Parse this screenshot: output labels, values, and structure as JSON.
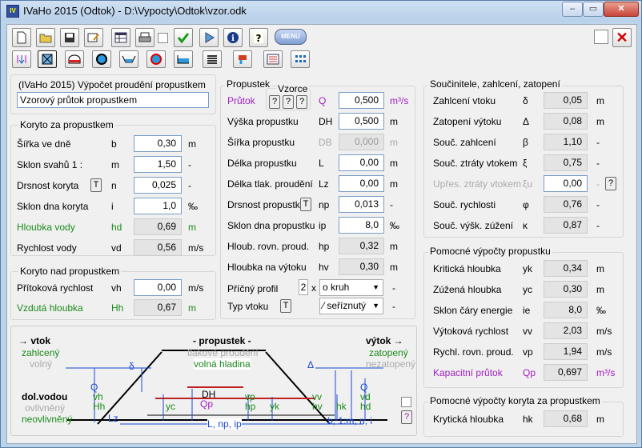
{
  "window": {
    "title": "IVaHo 2015 (Odtok)  -  D:\\Vypocty\\Odtok\\vzor.odk",
    "min": "–",
    "max": "▭",
    "close": "✕"
  },
  "toolbar": {
    "menu_label": "MENU",
    "close": "✕"
  },
  "left": {
    "header": "(IVaHo 2015) Výpočet proudění propustkem",
    "name_value": "Vzorový průtok propustkem",
    "koryto_za": {
      "title": "Koryto za propustkem",
      "rows": [
        {
          "label": "Šířka ve dně",
          "sym": "b",
          "value": "0,30",
          "unit": "m"
        },
        {
          "label": "Sklon svahů  1 :",
          "sym": "m",
          "value": "1,50",
          "unit": "-"
        },
        {
          "label": "Drsnost koryta",
          "sym": "n",
          "value": "0,025",
          "unit": "-",
          "t": "T"
        },
        {
          "label": "Sklon dna koryta",
          "sym": "i",
          "value": "1,0",
          "unit": "‰"
        },
        {
          "label": "Hloubka vody",
          "sym": "hd",
          "value": "0,69",
          "unit": "m"
        },
        {
          "label": "Rychlost vody",
          "sym": "vd",
          "value": "0,56",
          "unit": "m/s"
        }
      ]
    },
    "koryto_nad": {
      "title": "Koryto nad propustkem",
      "rows": [
        {
          "label": "Přítoková rychlost",
          "sym": "vh",
          "value": "0,00",
          "unit": "m/s"
        },
        {
          "label": "Vzdutá hloubka",
          "sym": "Hh",
          "value": "0,67",
          "unit": "m"
        }
      ]
    }
  },
  "mid": {
    "title": "Propustek",
    "vzorce": "Vzorce",
    "q": "?",
    "rows": [
      {
        "label": "Průtok",
        "sym": "Q",
        "value": "0,500",
        "unit": "m³/s"
      },
      {
        "label": "Výška propustku",
        "sym": "DH",
        "value": "0,500",
        "unit": "m"
      },
      {
        "label": "Šířka propustku",
        "sym": "DB",
        "value": "0,000",
        "unit": "m"
      },
      {
        "label": "Délka propustku",
        "sym": "L",
        "value": "0,00",
        "unit": "m"
      },
      {
        "label": "Délka tlak. proudění",
        "sym": "Lz",
        "value": "0,00",
        "unit": "m"
      },
      {
        "label": "Drsnost propustku",
        "sym": "np",
        "value": "0,013",
        "unit": "-",
        "t": "T"
      },
      {
        "label": "Sklon dna propustku",
        "sym": "ip",
        "value": "8,0",
        "unit": "‰"
      },
      {
        "label": "Hloub. rovn. proud.",
        "sym": "hp",
        "value": "0,32",
        "unit": "m"
      },
      {
        "label": "Hloubka na výtoku",
        "sym": "hv",
        "value": "0,30",
        "unit": "m"
      }
    ],
    "profil": {
      "label": "Příčný profil",
      "count": "2",
      "x": "x",
      "value": "o  kruh",
      "unit": "-"
    },
    "vtok": {
      "label": "Typ vtoku",
      "t": "T",
      "value": "⁄  seříznutý",
      "unit": "-"
    }
  },
  "right": {
    "title": "Součinitele, zahlcení, zatopení",
    "rows": [
      {
        "label": "Zahlcení vtoku",
        "sym": "δ",
        "value": "0,05",
        "unit": "m"
      },
      {
        "label": "Zatopení výtoku",
        "sym": "Δ",
        "value": "0,08",
        "unit": "m"
      },
      {
        "label": "Souč. zahlcení",
        "sym": "β",
        "value": "1,10",
        "unit": "-"
      },
      {
        "label": "Souč. ztráty vtokem",
        "sym": "ξ",
        "value": "0,75",
        "unit": "-"
      },
      {
        "label": "Upřes. ztráty vtokem",
        "sym": "ξu",
        "value": "0,00",
        "unit": "-",
        "q": "?"
      },
      {
        "label": "Souč. rychlosti",
        "sym": "φ",
        "value": "0,76",
        "unit": "-"
      },
      {
        "label": "Souč. výšk. zúžení",
        "sym": "κ",
        "value": "0,87",
        "unit": "-"
      }
    ],
    "pomocne": {
      "title": "Pomocné výpočty propustku",
      "rows": [
        {
          "label": "Kritická hloubka",
          "sym": "yk",
          "value": "0,34",
          "unit": "m"
        },
        {
          "label": "Zúžená hloubka",
          "sym": "yc",
          "value": "0,30",
          "unit": "m"
        },
        {
          "label": "Sklon čáry energie",
          "sym": "ie",
          "value": "8,0",
          "unit": "‰"
        },
        {
          "label": "Výtoková rychlost",
          "sym": "vv",
          "value": "2,03",
          "unit": "m/s"
        },
        {
          "label": "Rychl. rovn. proud.",
          "sym": "vp",
          "value": "1,94",
          "unit": "m/s"
        },
        {
          "label": "Kapacitní průtok",
          "sym": "Qp",
          "value": "0,697",
          "unit": "m³/s"
        }
      ]
    },
    "pomocne_koryto": {
      "title": "Pomocné výpočty koryta za propustkem",
      "row": {
        "label": "Krytická hloubka",
        "sym": "hk",
        "value": "0,68",
        "unit": "m"
      }
    }
  },
  "diagram": {
    "vtok": "→  vtok",
    "zahlceny": "zahlcený",
    "volny": "volný",
    "propustek": "- propustek -",
    "tlakove": "tlakové proudění",
    "volna_hladina": "volná hladina",
    "vytok": "výtok  →",
    "zatopeny": "zatopený",
    "nezatopeny": "nezatopený",
    "dol_vodou": "dol.vodou",
    "ovlivneny": "ovlivněný",
    "neovlivneny": "neovlivněný",
    "delta_small": "δ",
    "delta_big": "Δ",
    "q_left": "Q",
    "vh": "vh",
    "Hh": "Hh",
    "yc": "yc",
    "DH": "DH",
    "Qp": "Qp",
    "vp": "vp",
    "hp": "hp",
    "yk": "yk",
    "vv": "vv",
    "hv": "hv",
    "hk": "hk",
    "q_right": "Q",
    "vd": "vd",
    "hd": "hd",
    "Lz": "Lz",
    "L": "L, np, ip",
    "b": "b, 1:m, n, i",
    "q": "?"
  }
}
